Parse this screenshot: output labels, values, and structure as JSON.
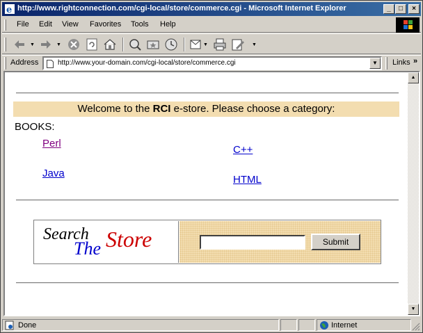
{
  "window": {
    "title": "http://www.rightconnection.com/cgi-local/store/commerce.cgi - Microsoft Internet Explorer",
    "minimize": "_",
    "maximize": "□",
    "close": "×"
  },
  "menu": [
    "File",
    "Edit",
    "View",
    "Favorites",
    "Tools",
    "Help"
  ],
  "toolbar": {
    "icons": [
      "back-icon",
      "forward-icon",
      "stop-icon",
      "refresh-icon",
      "home-icon",
      "search-icon",
      "favorites-icon",
      "history-icon",
      "mail-icon",
      "print-icon",
      "edit-icon"
    ]
  },
  "address": {
    "label": "Address",
    "url": "http://www.your-domain.com/cgi-local/store/commerce.cgi",
    "links_label": "Links",
    "links_chevron": "»"
  },
  "page": {
    "welcome_prefix": "Welcome to the ",
    "welcome_brand": "RCI",
    "welcome_suffix": " e-store. Please choose a category:",
    "books_label": "BOOKS:",
    "categories": [
      "Perl",
      "C++",
      "Java",
      "HTML"
    ],
    "search": {
      "logo_word1": "Search",
      "logo_word2": "The",
      "logo_word3": "Store",
      "input_value": "",
      "submit_label": "Submit"
    }
  },
  "status": {
    "text": "Done",
    "zone": "Internet"
  },
  "colors": {
    "title_gradient_start": "#0a246a",
    "title_gradient_end": "#3a6ea5",
    "welcome_bg": "#f3ddb0",
    "link": "#0000cc",
    "visited_link": "#800080",
    "logo_red": "#cc0000",
    "logo_blue": "#0000cc"
  }
}
